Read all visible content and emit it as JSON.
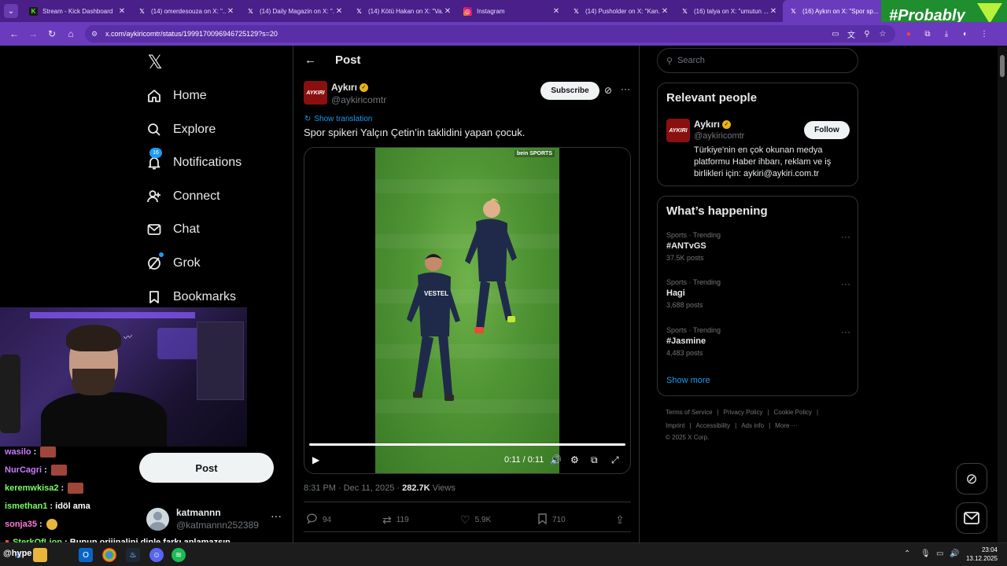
{
  "browser": {
    "tabs": [
      {
        "title": "Stream - Kick Dashboard",
        "icon": "kick-icon"
      },
      {
        "title": "(14) omerdesouza on X: \"...",
        "icon": "x-icon"
      },
      {
        "title": "(14) Daily Magazin on X: \"...",
        "icon": "x-icon"
      },
      {
        "title": "(14) Kötü Hakan on X: \"Va...",
        "icon": "x-icon"
      },
      {
        "title": "Instagram",
        "icon": "instagram-icon"
      },
      {
        "title": "(14) Pusholder on X: \"Kan...",
        "icon": "x-icon"
      },
      {
        "title": "(16) talya on X: \"umutun ...",
        "icon": "x-icon"
      },
      {
        "title": "(16) Aykırı on X: \"Spor sp...",
        "icon": "x-icon"
      }
    ],
    "active_tab": 7,
    "url": "x.com/aykiricomtr/status/1999170096946725129?s=20",
    "overlay_badge": "#Probably"
  },
  "nav": {
    "items": [
      {
        "label": "Home",
        "icon": "home-icon"
      },
      {
        "label": "Explore",
        "icon": "search-icon"
      },
      {
        "label": "Notifications",
        "icon": "bell-icon",
        "badge": "16"
      },
      {
        "label": "Connect",
        "icon": "person-add-icon"
      },
      {
        "label": "Chat",
        "icon": "mail-icon"
      },
      {
        "label": "Grok",
        "icon": "grok-icon"
      },
      {
        "label": "Bookmarks",
        "icon": "bookmark-icon"
      }
    ],
    "post_button": "Post",
    "account": {
      "name": "katmannn",
      "handle": "@katmannn252389"
    }
  },
  "main": {
    "header_title": "Post",
    "author": {
      "name": "Aykırı",
      "handle": "@aykiricomtr",
      "avatar_text": "AYKIRI"
    },
    "subscribe_label": "Subscribe",
    "show_translation": "Show translation",
    "text": "Spor spikeri Yalçın Çetin’in taklidini yapan çocuk.",
    "video": {
      "watermark": "bein SPORTS",
      "time": "0:11 / 0:11",
      "progress": 1.0
    },
    "meta": {
      "time": "8:31 PM · Dec 11, 2025 · ",
      "views": "282.7K",
      "views_label": " Views"
    },
    "actions": {
      "replies": "94",
      "reposts": "119",
      "likes": "5.9K",
      "bookmarks": "710"
    }
  },
  "right": {
    "search_placeholder": "Search",
    "relevant": {
      "title": "Relevant people",
      "name": "Aykırı",
      "handle": "@aykiricomtr",
      "follow_label": "Follow",
      "bio": "Türkiye'nin en çok okunan medya platformu Haber ihbarı, reklam ve iş birlikleri için: aykiri@aykiri.com.tr"
    },
    "happening": {
      "title": "What’s happening",
      "trends": [
        {
          "category": "Sports · Trending",
          "name": "#ANTvGS",
          "count": "37.5K posts"
        },
        {
          "category": "Sports · Trending",
          "name": "Hagi",
          "count": "3,688 posts"
        },
        {
          "category": "Sports · Trending",
          "name": "#Jasmine",
          "count": "4,483 posts"
        }
      ],
      "show_more": "Show more"
    },
    "footer": {
      "row1": [
        "Terms of Service",
        "|",
        "Privacy Policy",
        "|",
        "Cookie Policy",
        "|"
      ],
      "row2": [
        "Imprint",
        "|",
        "Accessibility",
        "|",
        "Ads info",
        "|",
        "More ···"
      ],
      "copyright": "© 2025 X Corp."
    }
  },
  "stream_chat": [
    {
      "user": "wasilo",
      "msg": "",
      "color": "#c77dff",
      "emote": true
    },
    {
      "user": "NurCagri",
      "msg": "",
      "color": "#c77dff",
      "emote": true
    },
    {
      "user": "keremwkisa2",
      "msg": "",
      "color": "#7cfc66",
      "emote": true
    },
    {
      "user": "ismethan1",
      "msg": "idöl ama",
      "color": "#7cfc66",
      "emote": false
    },
    {
      "user": "sonja35",
      "msg": "",
      "color": "#ff7ad9",
      "emote": true
    },
    {
      "user": "SterkOfLion",
      "msg": "Bunun orijinalini dinle farkı anlamazsın",
      "color": "#7cfc66",
      "emote": false
    }
  ],
  "stream_hype": "@hype",
  "taskbar": {
    "time": "23:04",
    "date": "13.12.2025"
  }
}
